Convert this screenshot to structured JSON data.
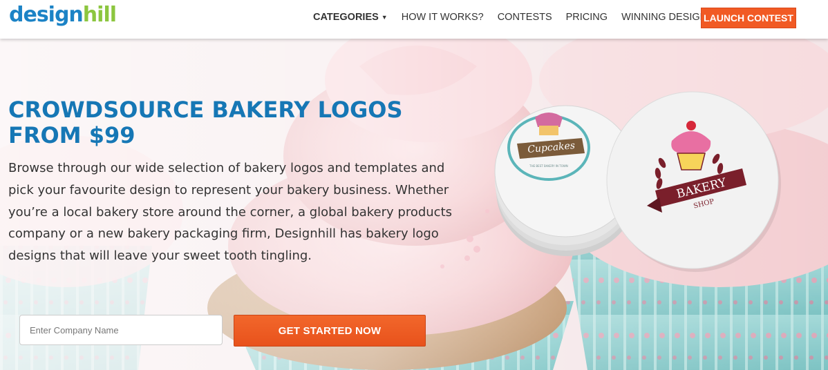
{
  "brand": {
    "part1": "design",
    "part2": "hill",
    "color1": "#1c83c6",
    "color2": "#8cc63f"
  },
  "nav": {
    "items": [
      {
        "label": "CATEGORIES",
        "has_dropdown": true
      },
      {
        "label": "HOW IT WORKS?"
      },
      {
        "label": "CONTESTS"
      },
      {
        "label": "PRICING"
      },
      {
        "label": "WINNING DESIGNS"
      }
    ],
    "launch_label": "LAUNCH CONTEST",
    "caret_icon": "caret-down-icon"
  },
  "hero": {
    "title_line1": "CROWDSOURCE BAKERY LOGOS",
    "title_line2": "FROM $99",
    "description": "Browse through our wide selection of bakery logos and templates and pick your favourite design to represent your bakery business. Whether you’re a local bakery store around the corner, a global bakery products company or a new bakery packaging firm, Designhill has bakery logo designs that will leave your sweet tooth tingling.",
    "input_placeholder": "Enter Company Name",
    "cta_label": "GET STARTED NOW"
  },
  "coasters": {
    "back": {
      "label": "Cupcakes",
      "small_text": "THE BEST BAKERY IN TOWN"
    },
    "front": {
      "label_top": "BAKERY",
      "label_bottom": "SHOP"
    }
  },
  "colors": {
    "accent": "#f15a24",
    "title": "#1677b5",
    "ribbon": "#7a1f2b"
  }
}
